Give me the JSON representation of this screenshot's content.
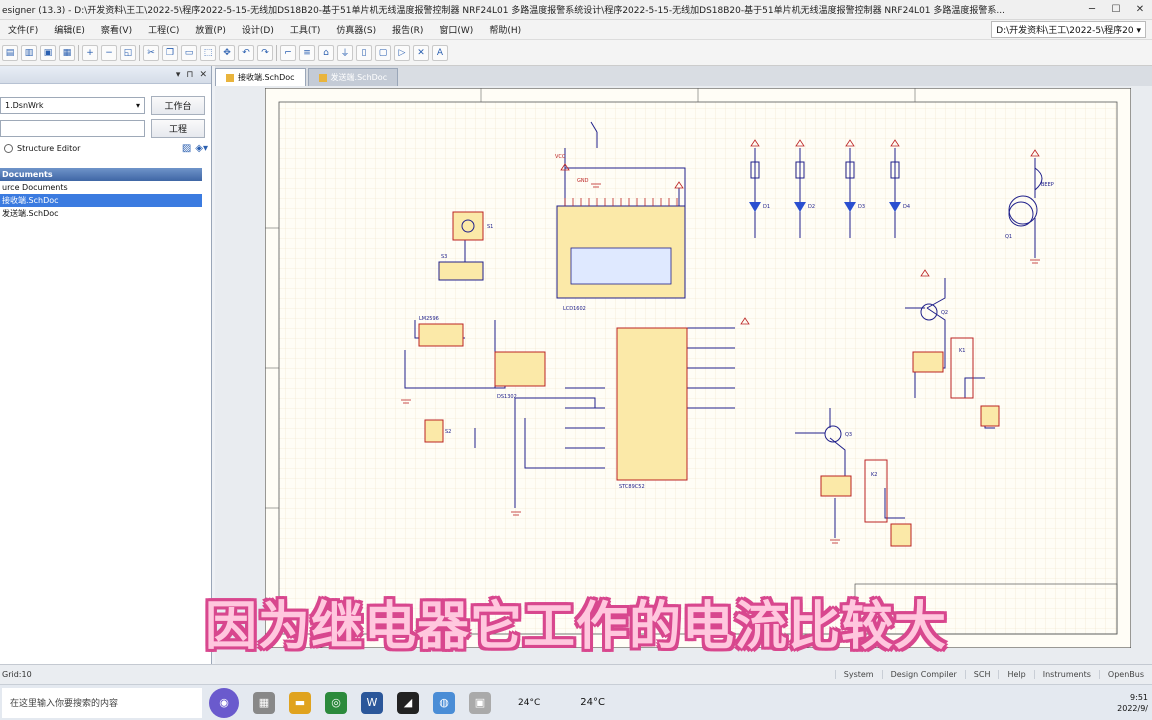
{
  "title": "esigner (13.3) - D:\\开发资料\\王工\\2022-5\\程序2022-5-15-无线加DS18B20-基于51单片机无线温度报警控制器 NRF24L01 多路温度报警系统设计\\程序2022-5-15-无线加DS18B20-基于51单片机无线温度报警控制器 NRF24L01 多路温度报警系...",
  "menu": [
    "文件(F)",
    "编辑(E)",
    "察看(V)",
    "工程(C)",
    "放置(P)",
    "设计(D)",
    "工具(T)",
    "仿真器(S)",
    "报告(R)",
    "窗口(W)",
    "帮助(H)"
  ],
  "menu_path": "D:\\开发资料\\王工\\2022-5\\程序20 ▾",
  "tabs": [
    {
      "label": "接收端.SchDoc",
      "active": true
    },
    {
      "label": "发送端.SchDoc",
      "active": false
    }
  ],
  "panel": {
    "workspace": "1.DsnWrk",
    "workspace_btn": "工作台",
    "project_btn": "工程",
    "structure_editor": "Structure Editor",
    "tree_header": "Documents",
    "tree_items": [
      "urce Documents",
      "接收端.SchDoc",
      "发送端.SchDoc"
    ]
  },
  "schematic": {
    "labels": [
      "LCD1602",
      "STC89C52",
      "DS1302",
      "LM2596",
      "Q1",
      "Q2",
      "Q3",
      "K1",
      "K2",
      "D1",
      "D2",
      "D3",
      "D4",
      "S1",
      "S2",
      "S3",
      "VCC",
      "GND",
      "BEEP"
    ]
  },
  "status": {
    "left": "Grid:10",
    "right": [
      "System",
      "Design Compiler",
      "SCH",
      "Help",
      "Instruments",
      "OpenBus"
    ]
  },
  "taskbar": {
    "search_placeholder": "在这里输入你要搜索的内容",
    "weather": "24°C",
    "time": "9:51",
    "date": "2022/9/"
  },
  "subtitle": "因为继电器它工作的电流比较大",
  "colors": {
    "accent": "#3b7be0",
    "subtitle_fill": "#ffc7de",
    "subtitle_stroke": "#d8478e",
    "wire": "#20208a",
    "component": "#fbe9a8"
  }
}
